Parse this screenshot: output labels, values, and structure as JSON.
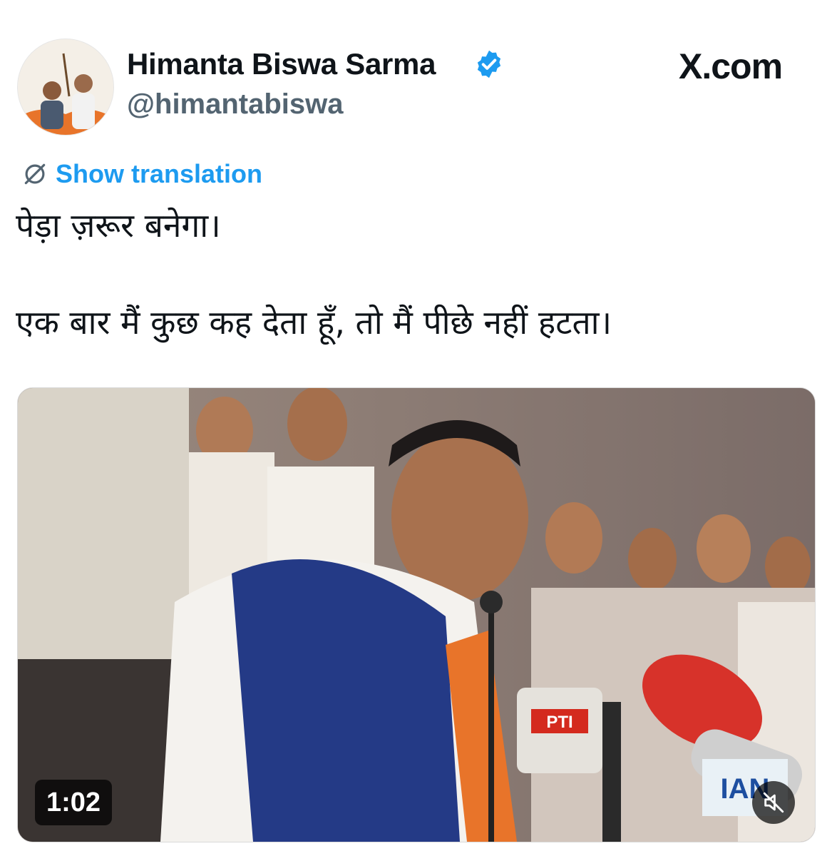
{
  "profile": {
    "display_name": "Himanta Biswa Sarma",
    "handle": "@himantabiswa",
    "verified": true,
    "avatar_icon": "profile-avatar"
  },
  "header": {
    "site_mark": "X.com"
  },
  "translation": {
    "label": "Show translation",
    "icon": "globe-icon"
  },
  "tweet": {
    "line1": "पेड़ा ज़रूर बनेगा।",
    "line2": "एक बार मैं कुछ कह देता हूँ, तो मैं पीछे नहीं हटता।"
  },
  "media": {
    "duration": "1:02",
    "muted": true,
    "mute_icon": "speaker-muted-icon",
    "mic_labels": [
      "PTI",
      "IAN"
    ]
  },
  "colors": {
    "link": "#1d9bf0",
    "verified": "#1d9bf0",
    "text": "#0f1419",
    "secondary_text": "#536471"
  }
}
